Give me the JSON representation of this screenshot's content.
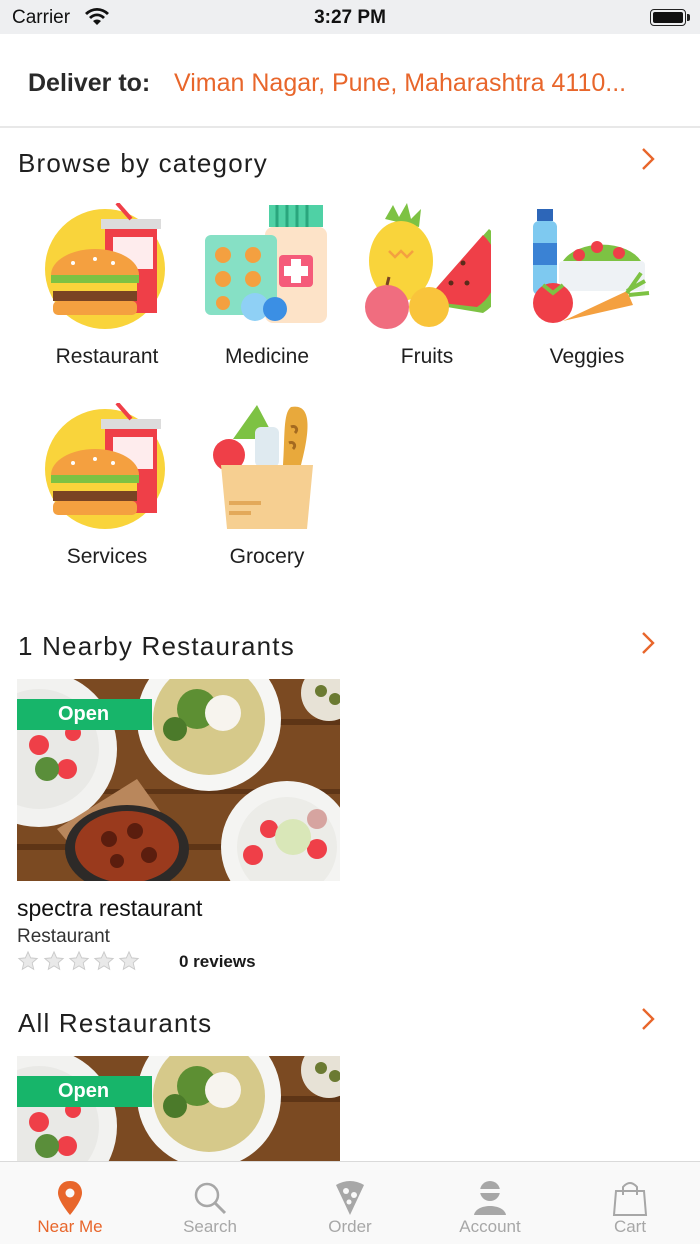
{
  "status_bar": {
    "carrier": "Carrier",
    "time": "3:27 PM"
  },
  "header": {
    "deliver_label": "Deliver to:",
    "address": "Viman Nagar, Pune, Maharashtra 4110..."
  },
  "browse": {
    "title": "Browse by category",
    "categories": [
      {
        "label": "Restaurant",
        "icon": "burger-drink-icon"
      },
      {
        "label": "Medicine",
        "icon": "medicine-icon"
      },
      {
        "label": "Fruits",
        "icon": "fruits-icon"
      },
      {
        "label": "Veggies",
        "icon": "veggies-icon"
      },
      {
        "label": "Services",
        "icon": "burger-drink-icon"
      },
      {
        "label": "Grocery",
        "icon": "grocery-bag-icon"
      }
    ]
  },
  "nearby": {
    "title": "1 Nearby Restaurants",
    "restaurants": [
      {
        "badge": "Open",
        "name": "spectra restaurant",
        "category": "Restaurant",
        "rating": 0,
        "reviews": "0 reviews"
      }
    ]
  },
  "all_restaurants": {
    "title": "All Restaurants",
    "restaurants": [
      {
        "badge": "Open"
      }
    ]
  },
  "tabs": [
    {
      "label": "Near Me",
      "icon": "location-pin-icon",
      "active": true
    },
    {
      "label": "Search",
      "icon": "search-icon",
      "active": false
    },
    {
      "label": "Order",
      "icon": "pizza-slice-icon",
      "active": false
    },
    {
      "label": "Account",
      "icon": "user-icon",
      "active": false
    },
    {
      "label": "Cart",
      "icon": "shopping-bag-icon",
      "active": false
    }
  ],
  "colors": {
    "accent": "#e8662b",
    "open_badge": "#17b56a",
    "inactive_tab": "#a7a7a7"
  }
}
